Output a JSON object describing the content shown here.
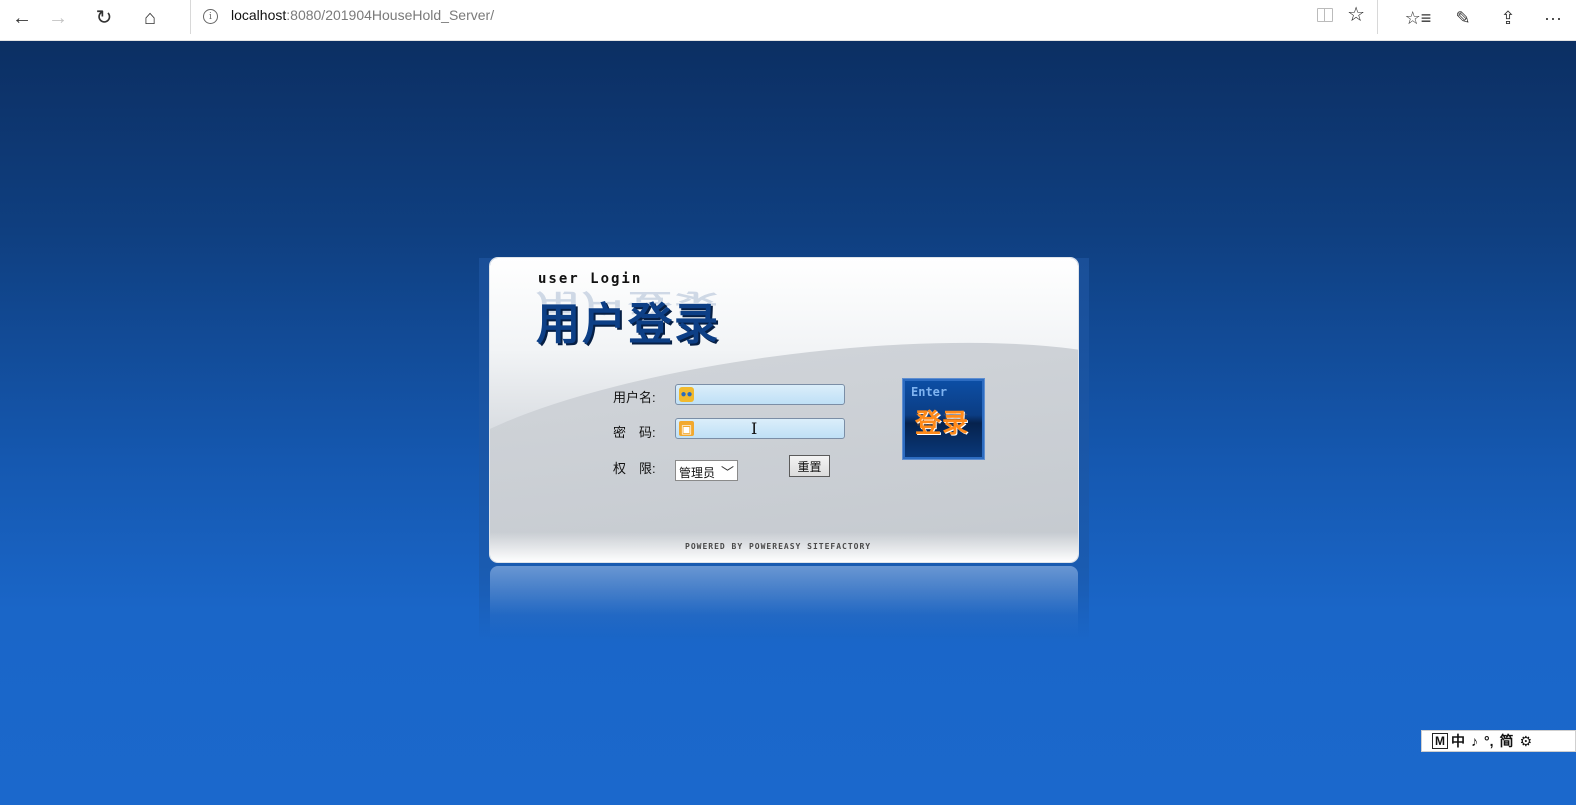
{
  "browser": {
    "back_icon": "←",
    "forward_icon": "→",
    "refresh_icon": "↻",
    "home_icon": "⌂",
    "info_icon": "i",
    "url_host": "localhost",
    "url_rest": ":8080/201904HouseHold_Server/",
    "favorite_icon": "☆",
    "favorites_list_icon": "☆≡",
    "pen_icon": "✎",
    "share_icon": "⇪",
    "more_icon": "···"
  },
  "login": {
    "en_title": "user Login",
    "cn_title": "用户登录",
    "username_label": "用户名:",
    "username_value": "",
    "password_label": "密　码:",
    "password_value": "",
    "role_label": "权　限:",
    "role_selected": "管理员",
    "reset_label": "重置",
    "enter_en": "Enter",
    "enter_cn": "登录",
    "powered_by": "POWERED BY POWEREASY SITEFACTORY"
  },
  "ime": {
    "mode_icon": "M",
    "lang": "中",
    "moon_icon": "♪",
    "punct_icon": "°,",
    "simplified": "简",
    "settings_icon": "⚙"
  }
}
